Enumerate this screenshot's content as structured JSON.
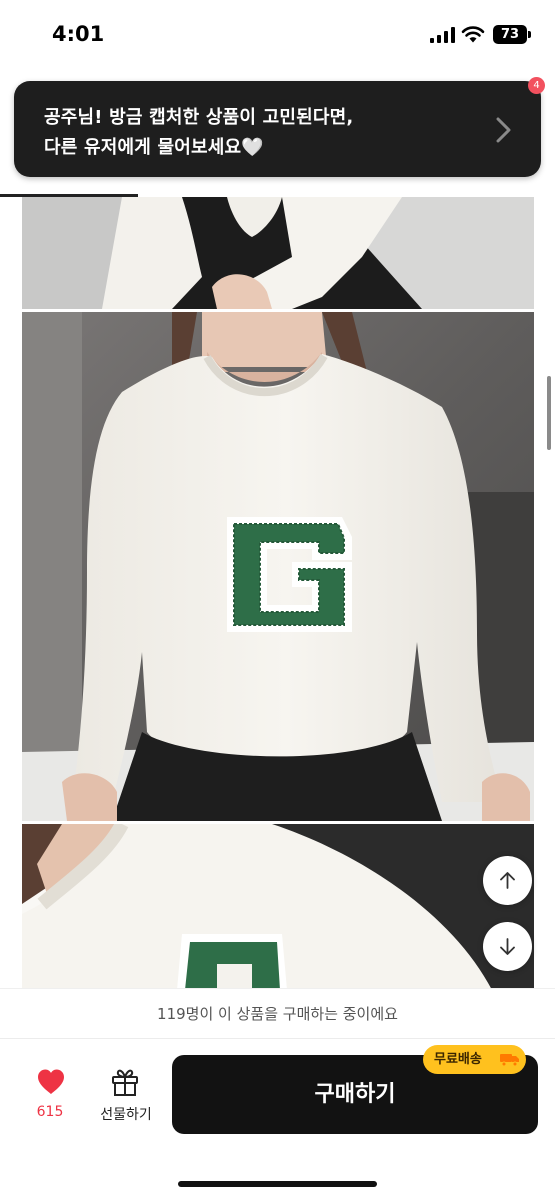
{
  "status_bar": {
    "time": "4:01",
    "battery": "73"
  },
  "toast": {
    "line1": "공주님! 방금 캡처한 상품이 고민된다면,",
    "line2": "다른 유저에게 물어보세요🤍"
  },
  "notification_badge": "4",
  "product_images": [
    {
      "name": "sweater-photo-top"
    },
    {
      "name": "sweater-photo-front",
      "letter": "G"
    },
    {
      "name": "sweater-photo-closeup"
    }
  ],
  "buying_notice": "119명이 이 상품을 구매하는 중이에요",
  "actions": {
    "like_count": "615",
    "gift_label": "선물하기",
    "buy_label": "구매하기",
    "free_shipping": "무료배송"
  },
  "colors": {
    "accent_like": "#ee3344",
    "free_shipping_badge": "#ffc11e",
    "buy_button": "#121212",
    "toast_bg": "#1e1e1e",
    "patch_green": "#2e6e48"
  }
}
